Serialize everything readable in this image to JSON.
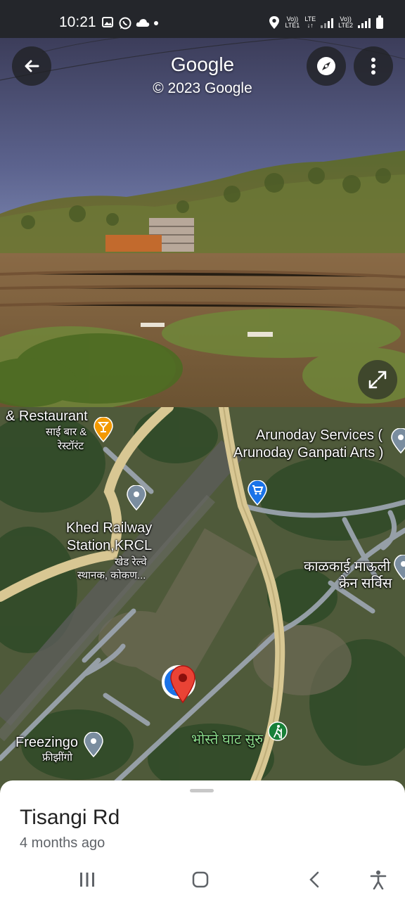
{
  "status_bar": {
    "time": "10:21",
    "left_icons": [
      "gallery-icon",
      "whatsapp-icon",
      "cloud-icon",
      "dot-icon"
    ],
    "sim1": {
      "top": "Vo))",
      "bottom": "LTE1",
      "network": "LTE"
    },
    "sim2": {
      "top": "Vo))",
      "bottom": "LTE2"
    },
    "right_icons": [
      "location-icon",
      "signal-icon",
      "battery-icon"
    ]
  },
  "street_view": {
    "title": "Google",
    "copyright": "© 2023 Google",
    "controls": [
      "back-arrow-icon",
      "compass-icon",
      "more-vert-icon",
      "expand-icon"
    ]
  },
  "map": {
    "labels": {
      "bar_en": "& Restaurant",
      "bar_mr": "साई बार &",
      "bar_mr2": "रेस्टॉरंट",
      "arunoday1": "Arunoday Services (",
      "arunoday2": "Arunoday Ganpati Arts )",
      "station1": "Khed Railway",
      "station2": "Station,KRCL",
      "station_mr1": "खेड रेल्वे",
      "station_mr2": "स्थानक, कोकण...",
      "crane1": "काळकाई माऊली",
      "crane2": "क्रेन सर्विस",
      "ghat": "भोस्ते घाट सुरु",
      "freezingo": "Freezingo",
      "freezingo_mr": "फ्रीझींगो"
    },
    "colors": {
      "road": "#d8c793",
      "road_minor": "#9aa3ad",
      "pin": "#ea4335",
      "location": "#1a73e8"
    }
  },
  "place": {
    "name": "Tisangi Rd",
    "captured": "4 months ago"
  },
  "nav_bar": [
    "recents-icon",
    "home-icon",
    "back-icon",
    "accessibility-icon"
  ]
}
